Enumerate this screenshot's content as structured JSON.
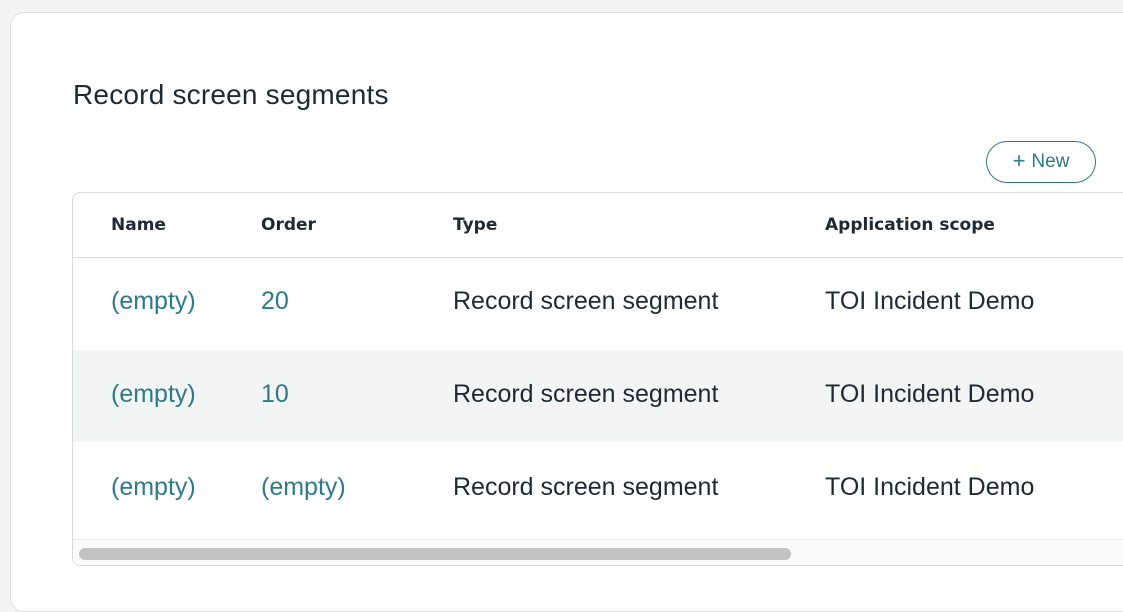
{
  "section": {
    "title": "Record screen segments",
    "new_button_label": "New"
  },
  "table": {
    "columns": [
      "Name",
      "Order",
      "Type",
      "Application scope"
    ],
    "rows": [
      {
        "name": "(empty)",
        "order": "20",
        "type": "Record screen segment",
        "scope": "TOI Incident Demo"
      },
      {
        "name": "(empty)",
        "order": "10",
        "type": "Record screen segment",
        "scope": "TOI Incident Demo"
      },
      {
        "name": "(empty)",
        "order": "(empty)",
        "type": "Record screen segment",
        "scope": "TOI Incident Demo"
      }
    ]
  },
  "icons": {
    "new_button_icon": "plus-icon"
  },
  "colors": {
    "link": "#2d7a89",
    "text": "#1f2933",
    "row_alt": "#f3f4f4",
    "border": "#d6dadc"
  },
  "scroll": {
    "horizontal_fraction_visible": 0.65
  }
}
